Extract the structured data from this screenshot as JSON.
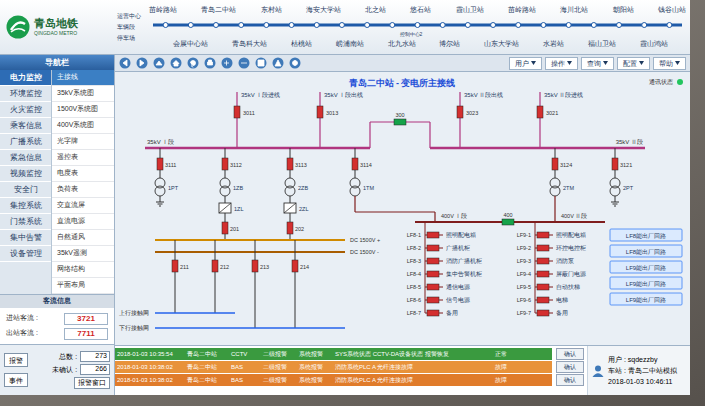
{
  "logo": {
    "cn": "青岛地铁",
    "en": "QINGDAO METRO"
  },
  "line_map": {
    "depots": [
      "运营中心",
      "车辆段",
      "停车场"
    ],
    "stations_top": [
      "苗岭路站",
      "青岛二中站",
      "东村站",
      "海安大学站",
      "北之站",
      "悠石站",
      "霞山卫站",
      "苗岭路站",
      "海川北站",
      "朝阳站",
      "钱谷山站"
    ],
    "stations_bottom": [
      "会展中心站",
      "青岛科大站",
      "枯桃站",
      "崂浦南站",
      "北九水站",
      "博尔站",
      "山东大学站",
      "水岩站",
      "福山卫站",
      "霞山鸿站"
    ],
    "control_label": "控制中心2"
  },
  "toolbar": {
    "menus": [
      "用户",
      "操作",
      "查询",
      "配置",
      "帮助"
    ]
  },
  "sidebar": {
    "title": "导航栏",
    "categories": [
      {
        "label": "电力监控",
        "selected": true
      },
      {
        "label": "环境监控",
        "selected": false
      },
      {
        "label": "火灾监控",
        "selected": false
      },
      {
        "label": "乘客信息",
        "selected": false
      },
      {
        "label": "广播系统",
        "selected": false
      },
      {
        "label": "紧急信息",
        "selected": false
      },
      {
        "label": "视频监控",
        "selected": false
      },
      {
        "label": "安全门",
        "selected": false
      },
      {
        "label": "集控系统",
        "selected": false
      },
      {
        "label": "门禁系统",
        "selected": false
      },
      {
        "label": "集中告警",
        "selected": false
      },
      {
        "label": "设备管理",
        "selected": false
      }
    ],
    "subitems": [
      {
        "label": "主接线",
        "selected": true
      },
      {
        "label": "35kV系统图",
        "selected": false
      },
      {
        "label": "1500V系统图",
        "selected": false
      },
      {
        "label": "400V系统图",
        "selected": false
      },
      {
        "label": "光字牌",
        "selected": false
      },
      {
        "label": "遥控表",
        "selected": false
      },
      {
        "label": "电度表",
        "selected": false
      },
      {
        "label": "负荷表",
        "selected": false
      },
      {
        "label": "交直流屏",
        "selected": false
      },
      {
        "label": "直流电源",
        "selected": false
      },
      {
        "label": "自然通风",
        "selected": false
      },
      {
        "label": "35kV遥测",
        "selected": false
      },
      {
        "label": "网络结构",
        "selected": false
      },
      {
        "label": "平面布局",
        "selected": false
      }
    ]
  },
  "passenger": {
    "title": "客流信息",
    "rows": [
      {
        "label": "进站客流 :",
        "value": "3721"
      },
      {
        "label": "出站客流 :",
        "value": "7711"
      }
    ]
  },
  "alarm_controls": {
    "alarm_button": "报警",
    "event_button": "事件",
    "total_label": "总数 :",
    "total": "273",
    "unack_label": "未确认 :",
    "unack": "266",
    "window_button": "报警窗口"
  },
  "diagram": {
    "title": "青岛二中站 - 变电所主接线",
    "comm": {
      "label": "通讯状态",
      "color": "#22c55e"
    },
    "incoming": [
      {
        "label": "35kV Ⅰ段进线",
        "breaker": "3011",
        "closed": true
      },
      {
        "label": "35kV Ⅰ段出线",
        "breaker": "3013",
        "closed": true
      },
      {
        "label": "35kV Ⅱ段出线",
        "breaker": "3023",
        "closed": true
      },
      {
        "label": "35kV Ⅱ段进线",
        "breaker": "3021",
        "closed": true
      }
    ],
    "coupler": {
      "breaker": "300",
      "closed": false
    },
    "bus_labels": [
      "35kV Ⅰ段",
      "35kV Ⅱ段"
    ],
    "feeders": [
      {
        "breaker": "3111",
        "device": "1PT",
        "kind": "pt",
        "closed": true
      },
      {
        "breaker": "3112",
        "device": "1ZB",
        "kind": "rectifier",
        "closed": true
      },
      {
        "breaker": "3113",
        "device": "2ZB",
        "kind": "rectifier",
        "closed": true
      },
      {
        "breaker": "3114",
        "device": "1TM",
        "kind": "power",
        "closed": true
      },
      {
        "breaker": "3124",
        "device": "2TM",
        "kind": "power",
        "closed": true
      },
      {
        "breaker": "3121",
        "device": "2PT",
        "kind": "pt",
        "closed": true
      }
    ],
    "rectifiers": [
      {
        "label": "1ZL",
        "breaker": "201",
        "closed": true
      },
      {
        "label": "2ZL",
        "breaker": "202",
        "closed": true
      }
    ],
    "dc_labels": [
      "DC 1500V +",
      "DC 1500V -"
    ],
    "dc_feeders": [
      {
        "breaker": "211",
        "closed": true
      },
      {
        "breaker": "212",
        "closed": true
      },
      {
        "breaker": "213",
        "closed": true
      },
      {
        "breaker": "214",
        "closed": true
      }
    ],
    "catenary": [
      "上行接触网",
      "下行接触网"
    ],
    "lv_labels": [
      "400V Ⅰ段",
      "400V Ⅱ段"
    ],
    "lv_coupler": {
      "breaker": "400",
      "closed": false
    },
    "lv_left": [
      {
        "id": "LF8-1",
        "name": "照明配电箱",
        "closed": true
      },
      {
        "id": "LF8-2",
        "name": "广播机柜",
        "closed": true
      },
      {
        "id": "LF8-3",
        "name": "消防广播机柜",
        "closed": true
      },
      {
        "id": "LF8-4",
        "name": "集中告警机柜",
        "closed": true
      },
      {
        "id": "LF8-5",
        "name": "通信电源",
        "closed": true
      },
      {
        "id": "LF8-6",
        "name": "信号电源",
        "closed": true
      },
      {
        "id": "LF8-7",
        "name": "备用",
        "closed": true
      }
    ],
    "lv_right": [
      {
        "id": "LF9-1",
        "name": "照明配电箱",
        "closed": true
      },
      {
        "id": "LF9-2",
        "name": "环控电控柜",
        "closed": true
      },
      {
        "id": "LF9-3",
        "name": "消防泵",
        "closed": true
      },
      {
        "id": "LF9-4",
        "name": "屏蔽门电源",
        "closed": true
      },
      {
        "id": "LF9-5",
        "name": "自动扶梯",
        "closed": true
      },
      {
        "id": "LF9-6",
        "name": "电梯",
        "closed": true
      },
      {
        "id": "LF9-7",
        "name": "备用",
        "closed": true
      }
    ],
    "buttons": [
      "LF8能出厂回路",
      "LF8能出厂回路",
      "LF9能出厂回路",
      "LF9能出厂回路",
      "LF9能出厂回路"
    ]
  },
  "alarms": {
    "rows": [
      {
        "cells": [
          "2018-01-03 10:35:54",
          "青岛二中站",
          "CCTV",
          "二级报警",
          "系统报警",
          "SYS系统状态 CCTV-DA设备状态 报警恢复",
          "正常"
        ],
        "color": "#3a9a3f",
        "confirm": "确认"
      },
      {
        "cells": [
          "2018-01-03 10:38:02",
          "青岛二中站",
          "BAS",
          "二级报警",
          "系统报警",
          "消防系统PLC A 光纤连接故障",
          "故障"
        ],
        "color": "#e8923a",
        "confirm": "确认"
      },
      {
        "cells": [
          "2018-01-03 10:38:02",
          "青岛二中站",
          "BAS",
          "二级报警",
          "系统报警",
          "消防系统PLC A 光纤连接故障",
          "故障"
        ],
        "color": "#e07b2a",
        "confirm": "确认"
      }
    ]
  },
  "status": {
    "user": "用户 : sqdezzby",
    "station": "车站 : 青岛二中站模拟",
    "time": "2018-01-03 10:46:11"
  }
}
